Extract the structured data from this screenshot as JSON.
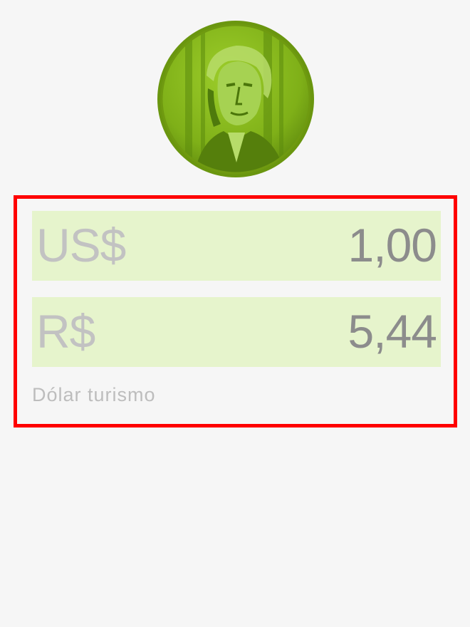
{
  "coin": {
    "icon": "dollar-coin-icon",
    "colors": {
      "rim": "#6f9a10",
      "face": "#86b81a",
      "portrait": "#4e7a0c"
    }
  },
  "converter": {
    "border_color": "#ff0000",
    "row_background": "#e6f4cc",
    "source": {
      "symbol": "US$",
      "value": "1,00"
    },
    "target": {
      "symbol": "R$",
      "value": "5,44"
    },
    "rate_type": "Dólar turismo"
  }
}
